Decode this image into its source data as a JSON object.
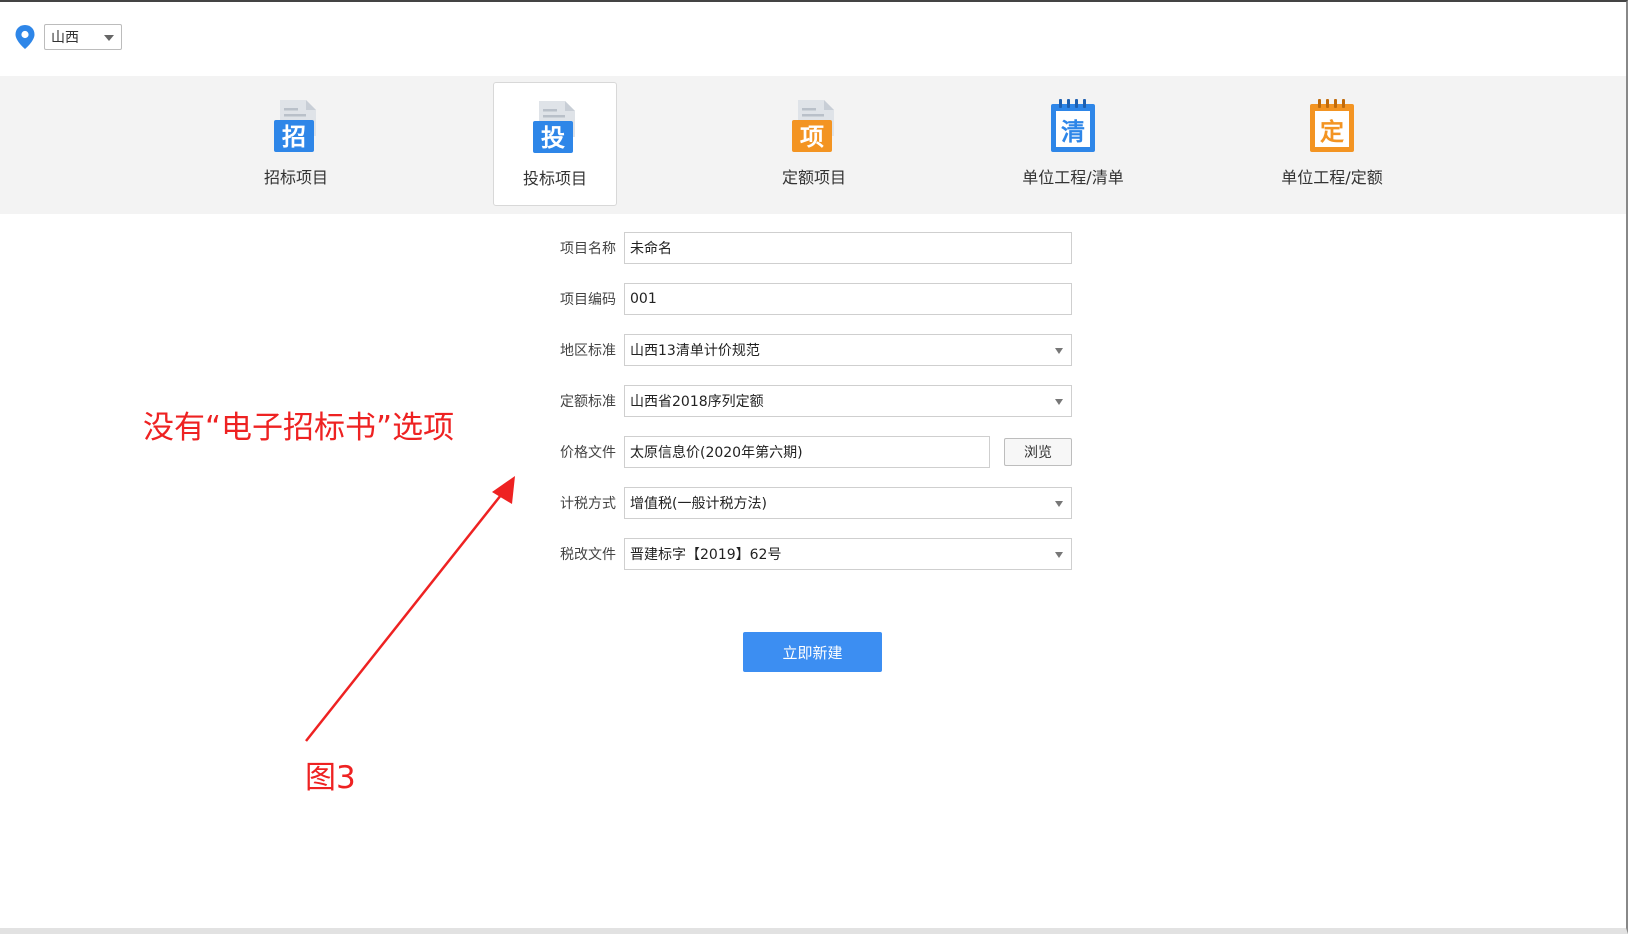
{
  "region": {
    "selected": "山西"
  },
  "types": [
    {
      "label": "招标项目",
      "glyph": "招",
      "color": "#2e86e8",
      "active": false
    },
    {
      "label": "投标项目",
      "glyph": "投",
      "color": "#2e86e8",
      "active": true
    },
    {
      "label": "定额项目",
      "glyph": "项",
      "color": "#f39422",
      "active": false
    },
    {
      "label": "单位工程/清单",
      "glyph": "清",
      "color": "#2e86e8",
      "active": false
    },
    {
      "label": "单位工程/定额",
      "glyph": "定",
      "color": "#f39422",
      "active": false
    }
  ],
  "form": {
    "project_name": {
      "label": "项目名称",
      "value": "未命名"
    },
    "project_code": {
      "label": "项目编码",
      "value": "001"
    },
    "region_standard": {
      "label": "地区标准",
      "value": "山西13清单计价规范"
    },
    "quota_standard": {
      "label": "定额标准",
      "value": "山西省2018序列定额"
    },
    "price_file": {
      "label": "价格文件",
      "value": "太原信息价(2020年第六期)",
      "browse": "浏览"
    },
    "tax_method": {
      "label": "计税方式",
      "value": "增值税(一般计税方法)"
    },
    "tax_reform_file": {
      "label": "税改文件",
      "value": "晋建标字【2019】62号"
    },
    "create_button": "立即新建"
  },
  "annotation": {
    "note": "没有“电子招标书”选项",
    "figure": "图3",
    "color": "#ee2222"
  },
  "colors": {
    "accent": "#3c8ef2",
    "blue_icon": "#2e86e8",
    "orange_icon": "#f39422"
  }
}
